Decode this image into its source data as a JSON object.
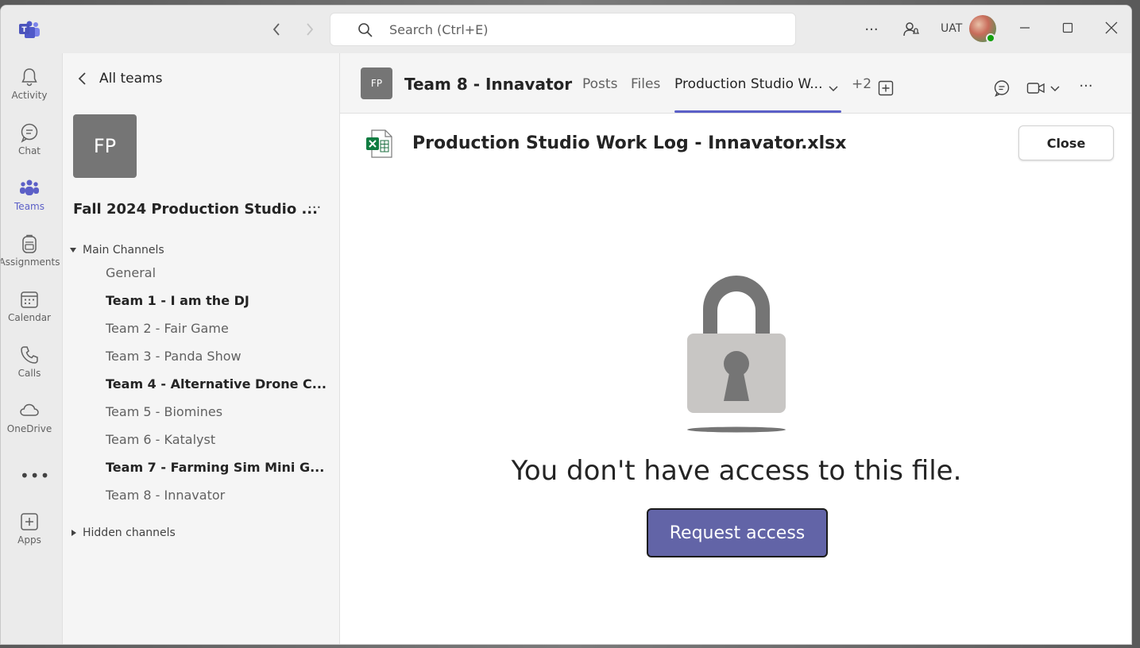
{
  "titlebar": {
    "nav_back_icon": "chevron-left-icon",
    "nav_forward_icon": "chevron-right-icon",
    "search_placeholder": "Search (Ctrl+E)",
    "more_label": "···",
    "user_label": "UAT"
  },
  "rail": {
    "items": [
      {
        "label": "Activity",
        "icon": "bell-icon"
      },
      {
        "label": "Chat",
        "icon": "chat-icon"
      },
      {
        "label": "Teams",
        "icon": "teams-icon"
      },
      {
        "label": "Assignments",
        "icon": "backpack-icon"
      },
      {
        "label": "Calendar",
        "icon": "calendar-icon"
      },
      {
        "label": "Calls",
        "icon": "phone-icon"
      },
      {
        "label": "OneDrive",
        "icon": "cloud-icon"
      },
      {
        "label": "Apps",
        "icon": "add-app-icon"
      }
    ],
    "more_label": "•••",
    "active_color": "#5b5fc7"
  },
  "sidepane": {
    "back_label": "All teams",
    "team_initials": "FP",
    "team_name": "Fall 2024 Production Studio ...",
    "more_label": "···",
    "main_channels_label": "Main Channels",
    "channels": [
      {
        "label": "General",
        "bold": false
      },
      {
        "label": "Team 1 - I am the DJ",
        "bold": true
      },
      {
        "label": "Team 2 - Fair Game",
        "bold": false
      },
      {
        "label": "Team 3 - Panda Show",
        "bold": false
      },
      {
        "label": "Team 4 - Alternative Drone C...",
        "bold": true
      },
      {
        "label": "Team 5 - Biomines",
        "bold": false
      },
      {
        "label": "Team 6 - Katalyst",
        "bold": false
      },
      {
        "label": "Team 7 - Farming Sim Mini G...",
        "bold": true
      },
      {
        "label": "Team 8 - Innavator",
        "bold": false
      }
    ],
    "hidden_channels_label": "Hidden channels"
  },
  "header": {
    "team_initials": "FP",
    "title": "Team 8 - Innavator",
    "tabs": [
      {
        "label": "Posts"
      },
      {
        "label": "Files"
      },
      {
        "label": "Production Studio W..."
      }
    ],
    "overflow_label": "+2",
    "accent": "#5b5fc7"
  },
  "file": {
    "title": "Production Studio Work Log - Innavator.xlsx",
    "close_label": "Close",
    "message": "You don't have access to this file.",
    "request_label": "Request access",
    "button_color": "#6264a7"
  }
}
